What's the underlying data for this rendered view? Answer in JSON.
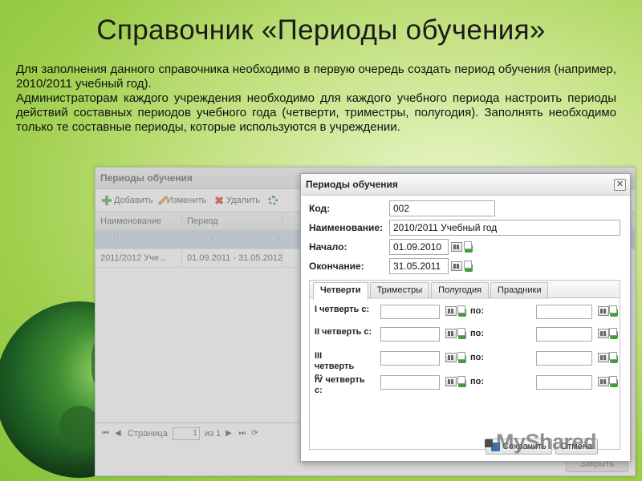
{
  "slide": {
    "title": "Справочник «Периоды обучения»",
    "paragraph1": "Для заполнения данного справочника необходимо в первую очередь создать период обучения (например, 2010/2011 учебный год).",
    "paragraph2": "Администраторам каждого учреждения необходимо для каждого учебного периода настроить периоды действий составных периодов учебного года (четверти, триместры, полугодия). Заполнять необходимо только те составные периоды, которые используются в учреждении."
  },
  "background_window": {
    "title": "Периоды обучения",
    "toolbar": {
      "add": "Добавить",
      "edit": "Изменить",
      "delete": "Удалить"
    },
    "columns": [
      "Наименование",
      "Период"
    ],
    "rows": [
      {
        "name": "2010/2011 Уче...",
        "period": "01.09.2010 - 31.05.2011",
        "selected": true
      },
      {
        "name": "2011/2012 Уче...",
        "period": "01.09.2011 - 31.05.2012",
        "selected": false
      }
    ],
    "pager": {
      "page_label": "Страница",
      "page_value": "1",
      "of_label": "из 1"
    },
    "close_button": "Закрыть"
  },
  "dialog": {
    "title": "Периоды обучения",
    "fields": {
      "code": {
        "label": "Код:",
        "value": "002"
      },
      "name": {
        "label": "Наименование:",
        "value": "2010/2011 Учебный год"
      },
      "start": {
        "label": "Начало:",
        "value": "01.09.2010"
      },
      "end": {
        "label": "Окончание:",
        "value": "31.05.2011"
      }
    },
    "tabs": [
      {
        "label": "Четверти",
        "active": true
      },
      {
        "label": "Триместры",
        "active": false
      },
      {
        "label": "Полугодия",
        "active": false
      },
      {
        "label": "Праздники",
        "active": false
      }
    ],
    "quarters": [
      {
        "label": "I четверть с:",
        "to_label": "по:"
      },
      {
        "label": "II четверть с:",
        "to_label": "по:"
      },
      {
        "label": "III четверть с:",
        "to_label": "по:"
      },
      {
        "label": "IV четверть с:",
        "to_label": "по:"
      }
    ],
    "footer": {
      "save": "Сохранить",
      "cancel": "Отмена"
    }
  },
  "watermark": "MyShared"
}
